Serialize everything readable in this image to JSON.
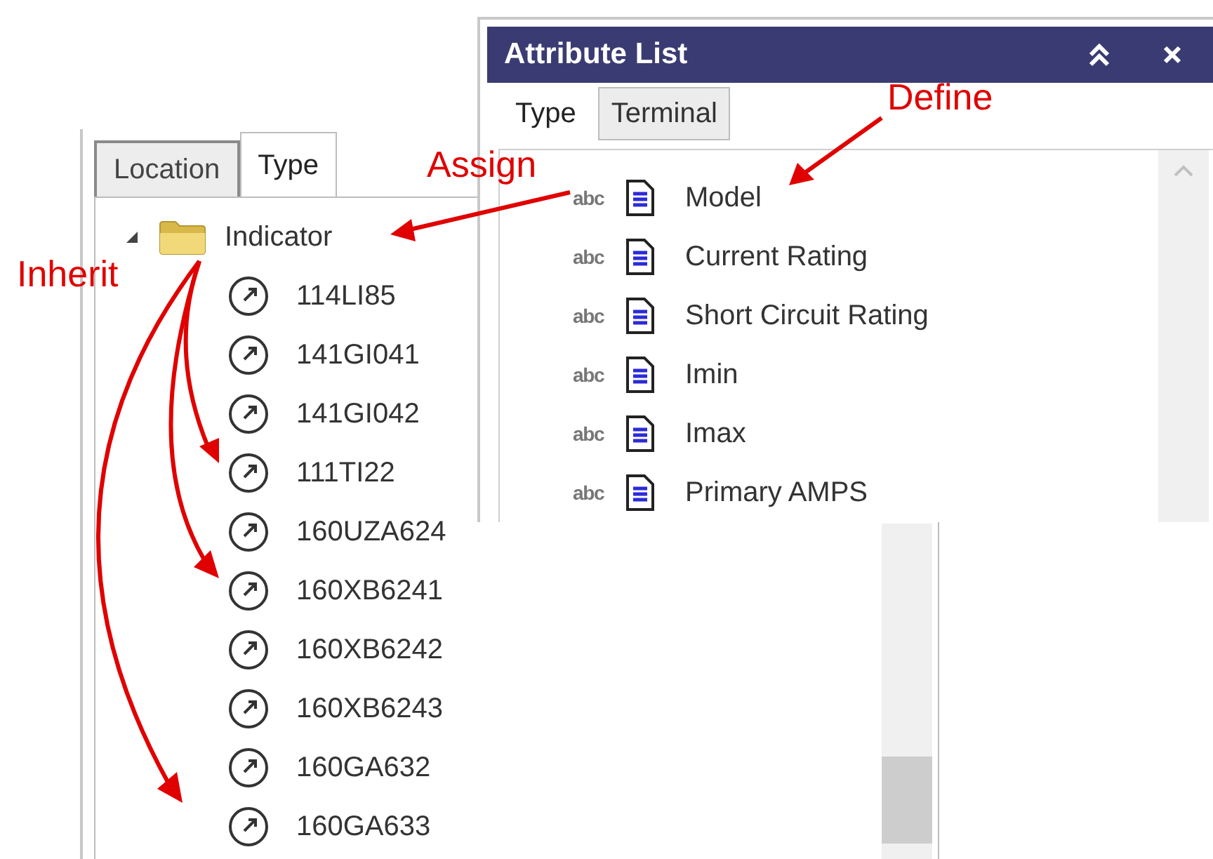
{
  "type_panel": {
    "tabs": [
      {
        "label": "Location",
        "selected": false
      },
      {
        "label": "Type",
        "selected": true
      }
    ],
    "tree": [
      {
        "label": "Indicator",
        "expanded": true,
        "children": [
          {
            "label": "114LI85"
          },
          {
            "label": "141GI041"
          },
          {
            "label": "141GI042"
          },
          {
            "label": "111TI22"
          },
          {
            "label": "160UZA624"
          },
          {
            "label": "160XB6241"
          },
          {
            "label": "160XB6242"
          },
          {
            "label": "160XB6243"
          },
          {
            "label": "160GA632"
          },
          {
            "label": "160GA633"
          }
        ]
      }
    ]
  },
  "attribute_list": {
    "title": "Attribute List",
    "tabs": [
      {
        "label": "Type",
        "selected": true
      },
      {
        "label": "Terminal",
        "selected": false
      }
    ],
    "attributes": [
      {
        "data_type": "abc",
        "name": "Model"
      },
      {
        "data_type": "abc",
        "name": "Current Rating"
      },
      {
        "data_type": "abc",
        "name": "Short Circuit Rating"
      },
      {
        "data_type": "abc",
        "name": "Imin"
      },
      {
        "data_type": "abc",
        "name": "Imax"
      },
      {
        "data_type": "abc",
        "name": "Primary AMPS"
      }
    ]
  },
  "annotations": [
    {
      "text": "Define"
    },
    {
      "text": "Assign"
    },
    {
      "text": "Inherit"
    }
  ]
}
